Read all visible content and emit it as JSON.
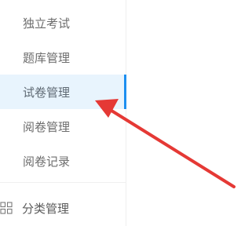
{
  "sidebar": {
    "items": [
      {
        "label": "独立考试",
        "active": false
      },
      {
        "label": "题库管理",
        "active": false
      },
      {
        "label": "试卷管理",
        "active": true
      },
      {
        "label": "阅卷管理",
        "active": false
      },
      {
        "label": "阅卷记录",
        "active": false
      }
    ],
    "group": {
      "label": "分类管理",
      "icon": "grid-icon"
    }
  },
  "colors": {
    "active_background": "#e8f4fd",
    "active_indicator": "#1d8ff0",
    "annotation_arrow": "#e53935"
  }
}
